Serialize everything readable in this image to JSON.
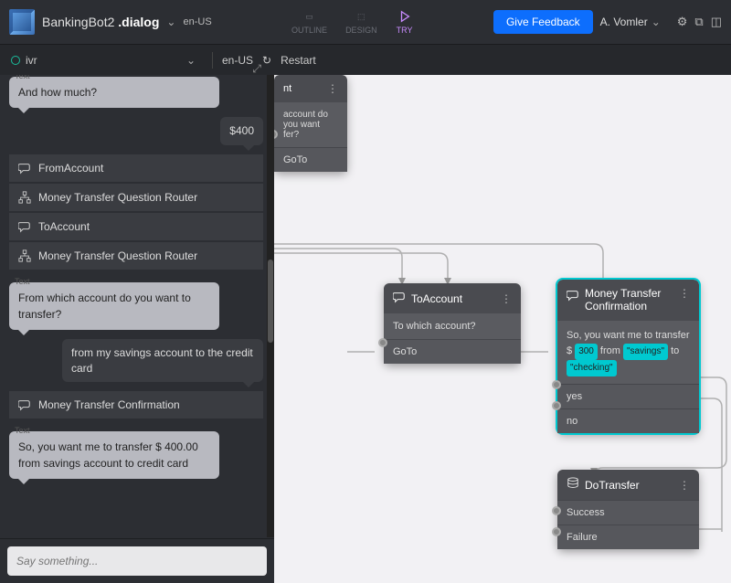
{
  "header": {
    "app_name_a": "BankingBot2 ",
    "app_name_b": ".dialog",
    "locale": "en-US",
    "tabs": {
      "outline": "OUTLINE",
      "design": "DESIGN",
      "try": "TRY"
    },
    "feedback": "Give Feedback",
    "user": "A. Vomler"
  },
  "subbar": {
    "channel": "ivr",
    "locale": "en-US",
    "restart": "Restart"
  },
  "chat": {
    "text_label": "Text",
    "bot1": "And how much?",
    "user1": "$400",
    "steps": [
      "FromAccount",
      "Money Transfer Question Router",
      "ToAccount",
      "Money Transfer Question Router"
    ],
    "bot2": "From which account do you want to transfer?",
    "user2": "from my savings account to the credit card",
    "step_confirm": "Money Transfer Confirmation",
    "bot3": "So, you want me to transfer $ 400.00 from savings account to credit card",
    "input_placeholder": "Say something..."
  },
  "nodes": {
    "partial": {
      "body": "account do you want fer?",
      "row": "GoTo"
    },
    "toaccount": {
      "title": "ToAccount",
      "body": "To which account?",
      "row": "GoTo"
    },
    "confirm": {
      "title": "Money Transfer Confirmation",
      "body_pre": "So, you want me to transfer $ ",
      "amount": "300",
      "body_mid": " from ",
      "from_acct": "\"savings\"",
      "body_mid2": " to ",
      "to_acct": "\"checking\"",
      "row_yes": "yes",
      "row_no": "no"
    },
    "dotransfer": {
      "title": "DoTransfer",
      "row_s": "Success",
      "row_f": "Failure"
    }
  }
}
